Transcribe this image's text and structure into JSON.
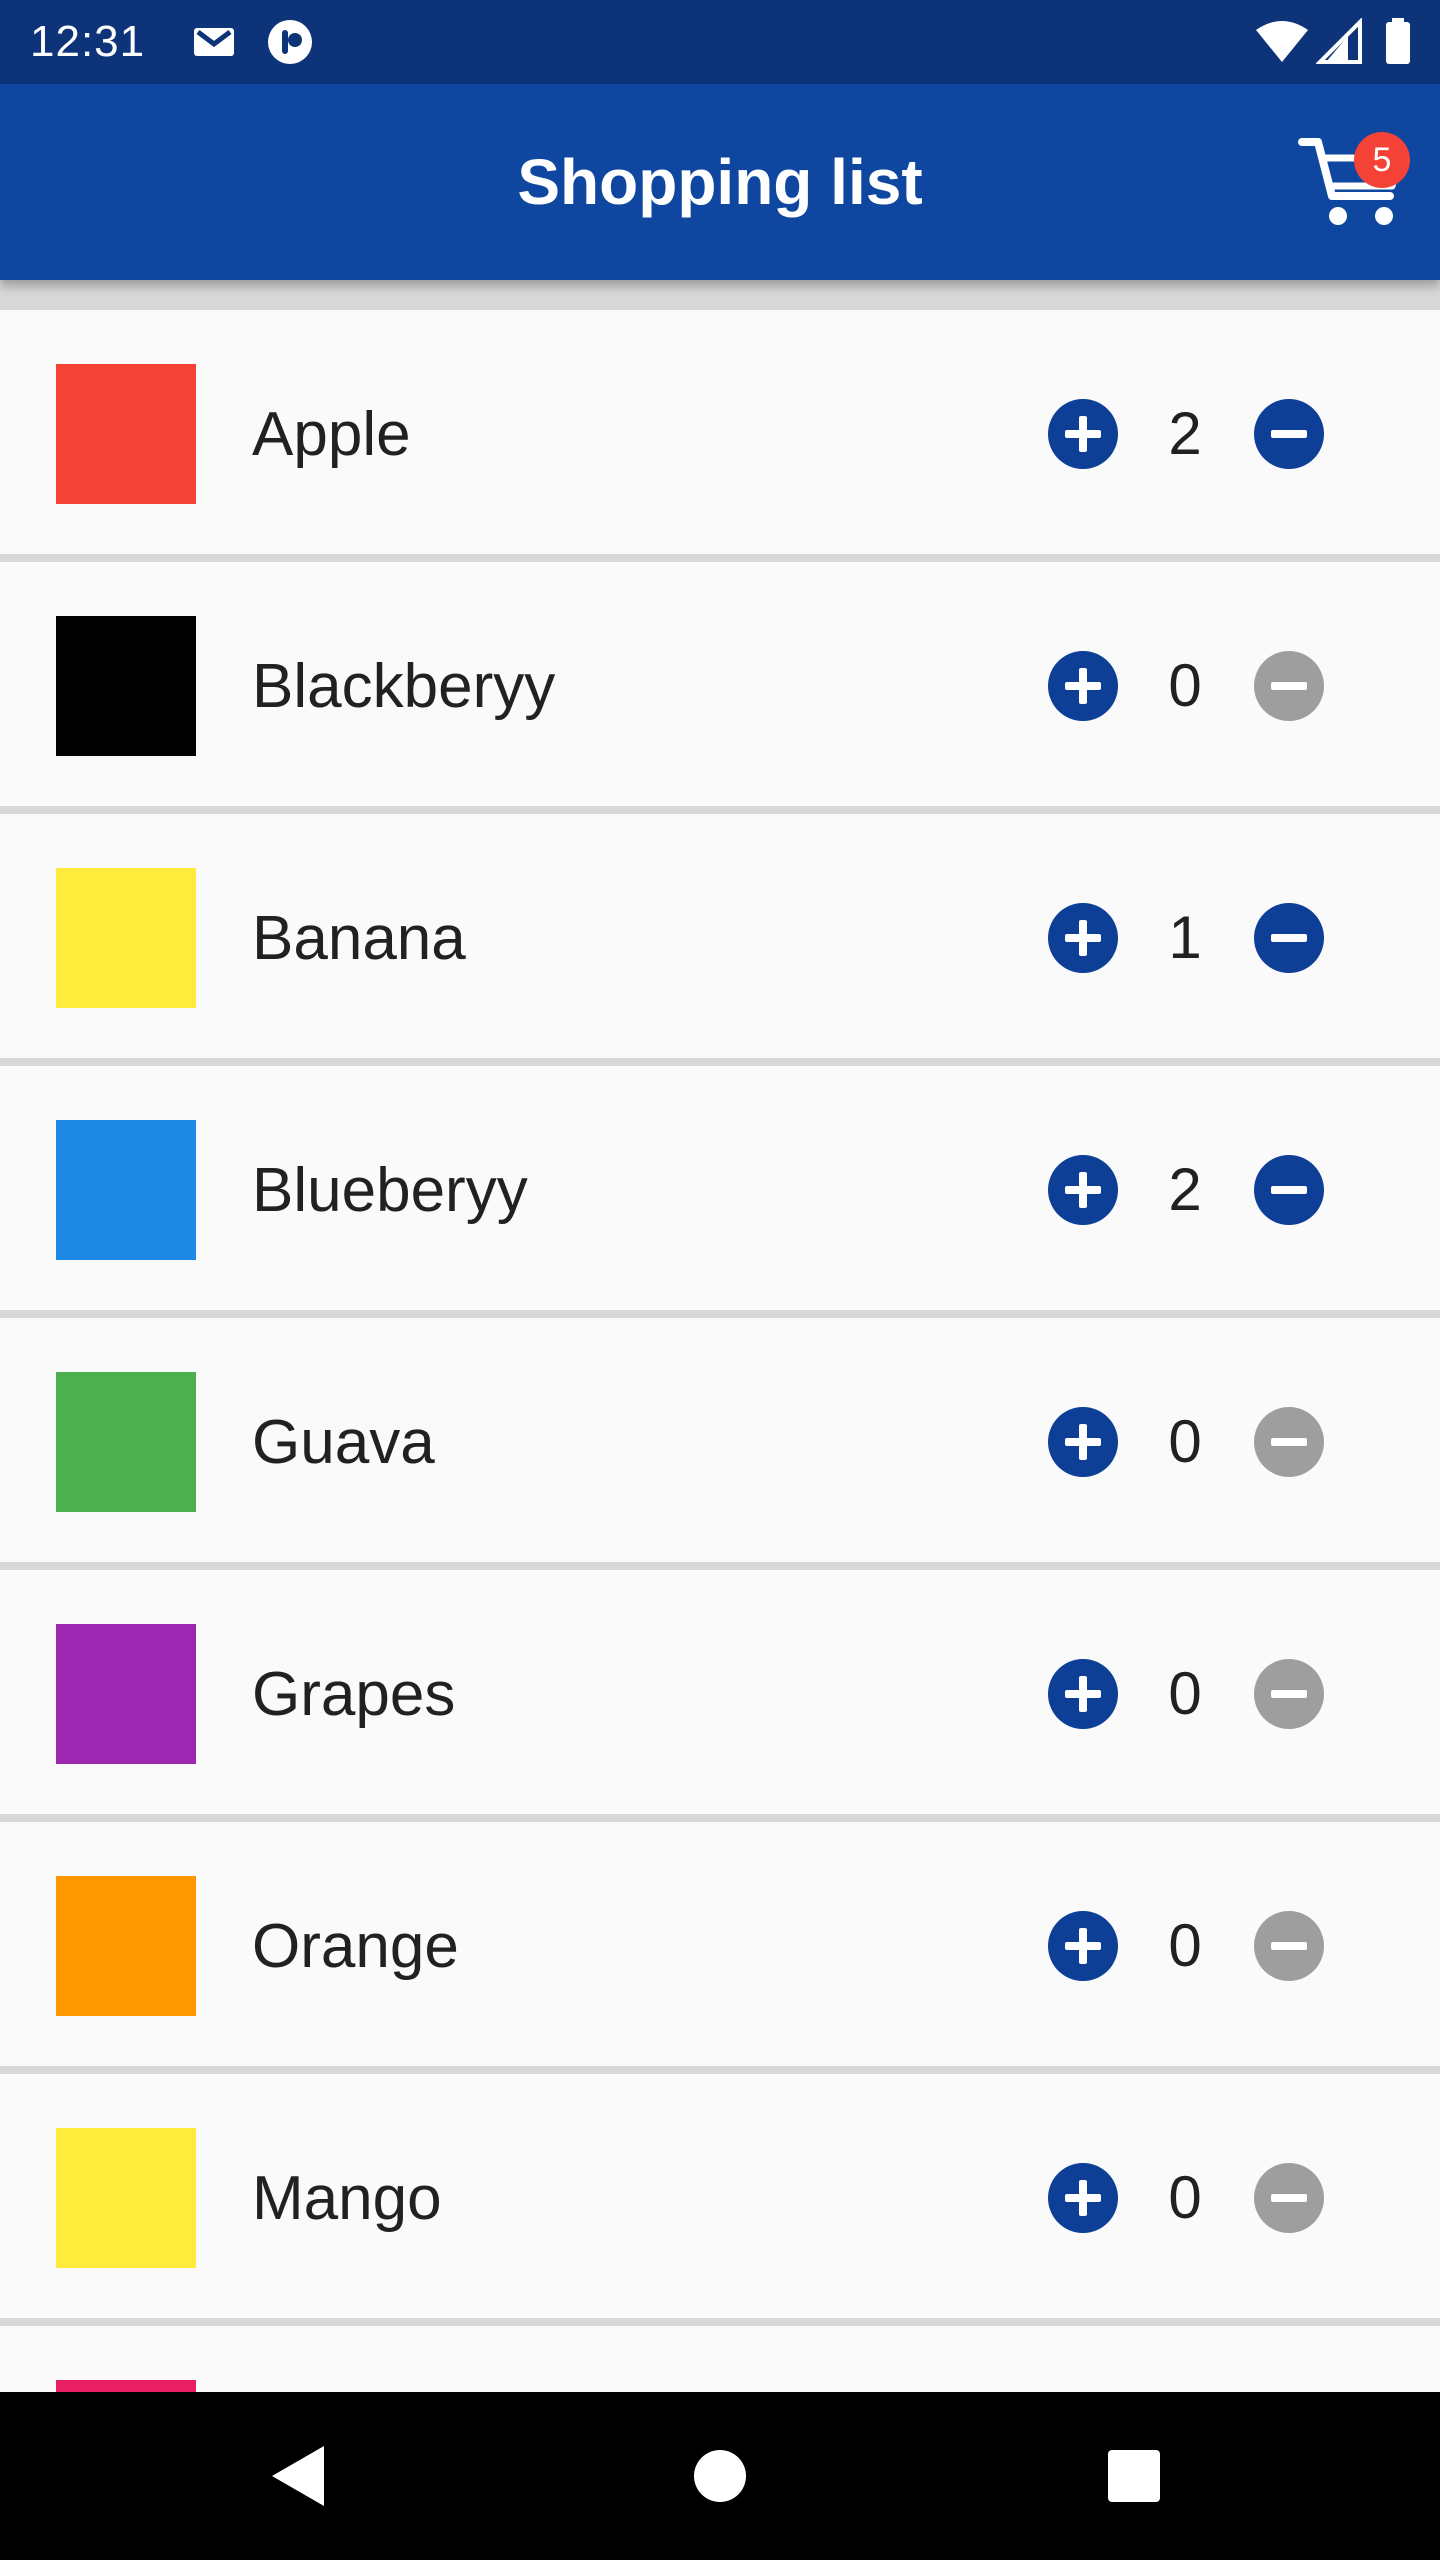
{
  "status_bar": {
    "time": "12:31",
    "left_icons": [
      "mail-icon",
      "notification-app-icon"
    ],
    "right_icons": [
      "wifi-icon",
      "cell-signal-icon",
      "battery-icon"
    ]
  },
  "app_bar": {
    "title": "Shopping list",
    "cart_icon": "cart-icon",
    "cart_badge": "5"
  },
  "colors": {
    "status_bar": "#0d3479",
    "app_bar": "#0f47a0",
    "button_active": "#0d3f97",
    "button_disabled": "#9e9e9e",
    "badge": "#f44336"
  },
  "items": [
    {
      "name": "Apple",
      "quantity": "2",
      "color": "#f44336",
      "minus_enabled": true
    },
    {
      "name": "Blackberyy",
      "quantity": "0",
      "color": "#000000",
      "minus_enabled": false
    },
    {
      "name": "Banana",
      "quantity": "1",
      "color": "#ffeb3b",
      "minus_enabled": true
    },
    {
      "name": "Blueberyy",
      "quantity": "2",
      "color": "#1e88e5",
      "minus_enabled": true
    },
    {
      "name": "Guava",
      "quantity": "0",
      "color": "#4caf50",
      "minus_enabled": false
    },
    {
      "name": "Grapes",
      "quantity": "0",
      "color": "#9c27b0",
      "minus_enabled": false
    },
    {
      "name": "Orange",
      "quantity": "0",
      "color": "#ff9800",
      "minus_enabled": false
    },
    {
      "name": "Mango",
      "quantity": "0",
      "color": "#ffeb3b",
      "minus_enabled": false
    },
    {
      "name": "",
      "quantity": "",
      "color": "#e91e63",
      "minus_enabled": false
    }
  ],
  "nav_bar": {
    "icons": [
      "back-icon",
      "home-icon",
      "recents-icon"
    ]
  }
}
